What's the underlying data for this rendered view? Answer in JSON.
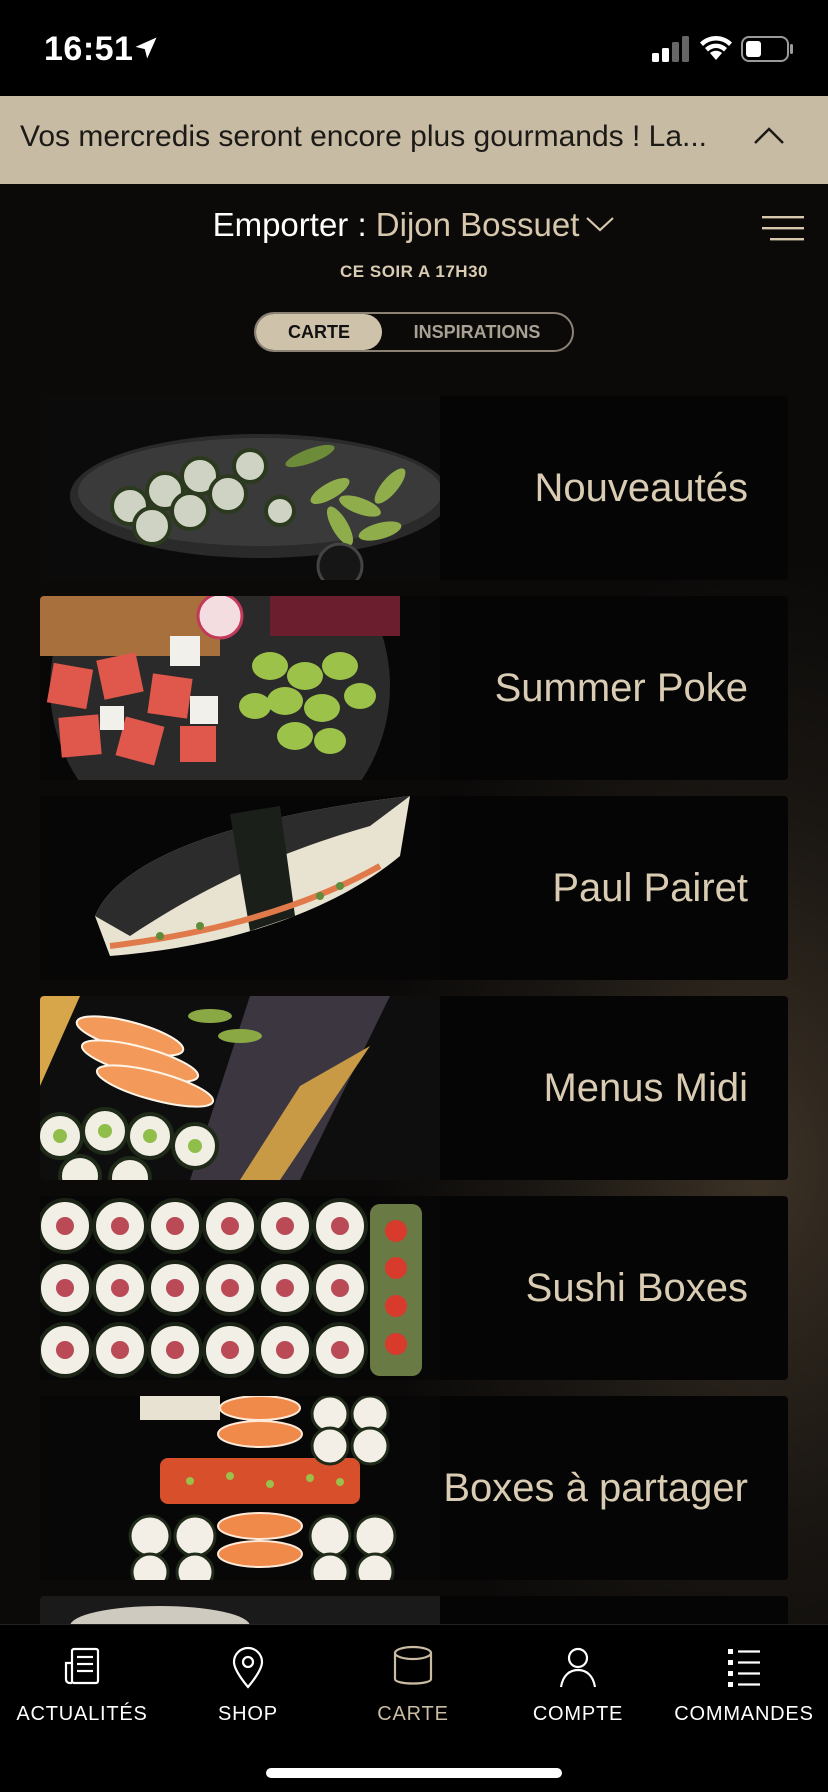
{
  "status_bar": {
    "time": "16:51",
    "icons": [
      "location-arrow-icon",
      "signal-icon",
      "wifi-icon",
      "battery-icon"
    ]
  },
  "banner": {
    "text": "Vos mercredis seront encore plus gourmands ! La...",
    "toggle_icon": "chevron-up-icon"
  },
  "header": {
    "mode_label": "Emporter : ",
    "store_name": "Dijon Bossuet",
    "pickup_time": "CE SOIR A 17H30",
    "menu_icon": "hamburger-menu-icon"
  },
  "segmented": {
    "active": "CARTE",
    "inactive": "INSPIRATIONS"
  },
  "categories": [
    {
      "label": "Nouveautés"
    },
    {
      "label": "Summer Poke"
    },
    {
      "label": "Paul Pairet"
    },
    {
      "label": "Menus Midi"
    },
    {
      "label": "Sushi Boxes"
    },
    {
      "label": "Boxes à partager"
    }
  ],
  "tabbar": {
    "items": [
      {
        "label": "ACTUALITÉS",
        "icon": "news-icon"
      },
      {
        "label": "SHOP",
        "icon": "map-pin-icon"
      },
      {
        "label": "CARTE",
        "icon": "cup-icon",
        "active": true
      },
      {
        "label": "COMPTE",
        "icon": "user-icon"
      },
      {
        "label": "COMMANDES",
        "icon": "list-icon"
      }
    ]
  },
  "colors": {
    "accent": "#c8bba4",
    "gold_text": "#d9ccb3",
    "background": "#0d0d0d"
  }
}
